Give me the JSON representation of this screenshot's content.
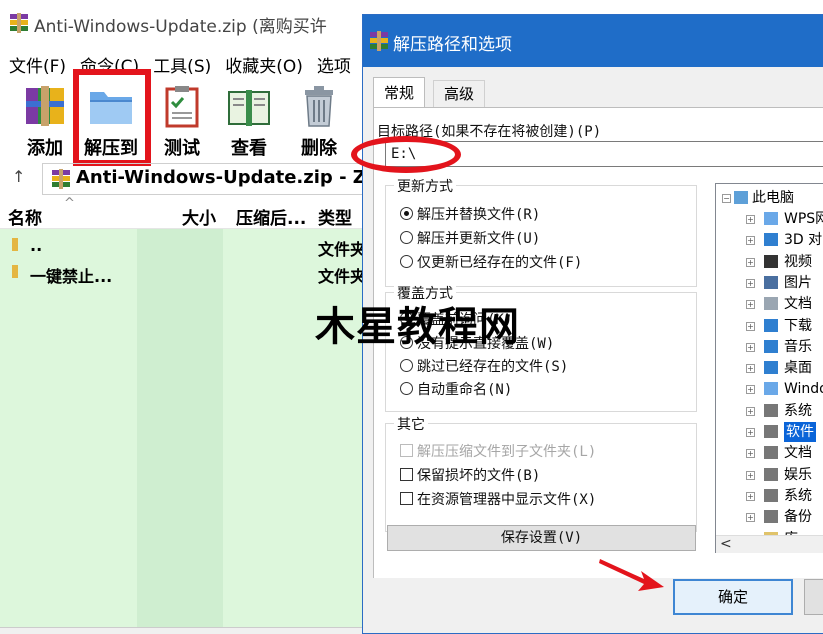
{
  "bg_window": {
    "title": "Anti-Windows-Update.zip (离购买许",
    "menu": [
      "文件(F)",
      "命令(C)",
      "工具(S)",
      "收藏夹(O)",
      "选项"
    ],
    "toolbar": {
      "add": "添加",
      "extract_to": "解压到",
      "test": "测试",
      "view": "查看",
      "delete": "删除"
    },
    "address_path": "Anti-Windows-Update.zip - ZIP",
    "columns": {
      "name": "名称",
      "size": "大小",
      "compressed": "压缩后...",
      "type": "类型"
    },
    "files": [
      {
        "name": "..",
        "type": "文件夹"
      },
      {
        "name": "一键禁止...",
        "type": "文件夹"
      }
    ]
  },
  "dialog": {
    "title": "解压路径和选项",
    "tabs": [
      "常规",
      "高级"
    ],
    "dest_label": "目标路径(如果不存在将被创建)(P)",
    "dest_value": "E:\\",
    "update_mode": {
      "label": "更新方式",
      "options": [
        {
          "label": "解压并替换文件(R)",
          "checked": true
        },
        {
          "label": "解压并更新文件(U)",
          "checked": false
        },
        {
          "label": "仅更新已经存在的文件(F)",
          "checked": false
        }
      ]
    },
    "overwrite_mode": {
      "label": "覆盖方式",
      "options": [
        {
          "label": "覆盖前询问(K)",
          "checked": true
        },
        {
          "label": "没有提示直接覆盖(W)",
          "checked": false
        },
        {
          "label": "跳过已经存在的文件(S)",
          "checked": false
        },
        {
          "label": "自动重命名(N)",
          "checked": false
        }
      ]
    },
    "misc": {
      "label": "其它",
      "options": [
        {
          "label": "解压压缩文件到子文件夹(L)",
          "checked": false,
          "disabled": true
        },
        {
          "label": "保留损坏的文件(B)",
          "checked": false,
          "disabled": false
        },
        {
          "label": "在资源管理器中显示文件(X)",
          "checked": false,
          "disabled": false
        }
      ]
    },
    "save_settings": "保存设置(V)",
    "tree": {
      "root": "此电脑",
      "items": [
        "WPS网",
        "3D 对",
        "视频",
        "图片",
        "文档",
        "下载",
        "音乐",
        "桌面",
        "Windo",
        "系统",
        "软件",
        "文档",
        "娱乐",
        "系统",
        "备份",
        "库"
      ],
      "selected_index": 10
    },
    "ok": "确定",
    "tree_scroll_left": "<"
  },
  "watermark": "木星教程网",
  "colors": {
    "dialog_title_bg": "#1f6dc8",
    "annotation_red": "#e3141c",
    "file_list_bg": "#ddf7dc"
  }
}
